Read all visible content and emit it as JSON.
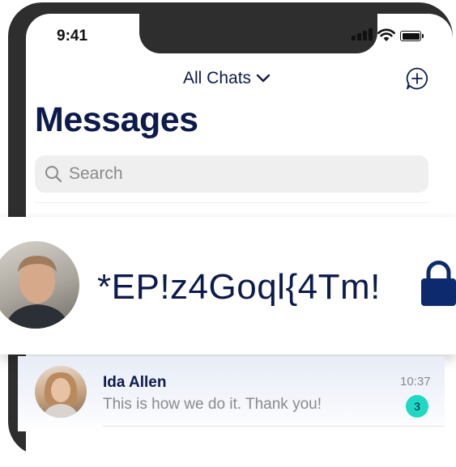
{
  "status_bar": {
    "time": "9:41"
  },
  "nav": {
    "title": "All Chats"
  },
  "page": {
    "title": "Messages"
  },
  "search": {
    "placeholder": "Search"
  },
  "overlay": {
    "text": "*EP!z4Goql{4Tm!"
  },
  "chats": [
    {
      "name": "Ida Allen",
      "preview": "This is how we do it. Thank you!",
      "time": "10:37",
      "unread": "3"
    }
  ],
  "colors": {
    "primary": "#0d1b4c",
    "badge": "#1fd8c3",
    "muted": "#8a8a8e",
    "frame": "#2e2e2e"
  }
}
